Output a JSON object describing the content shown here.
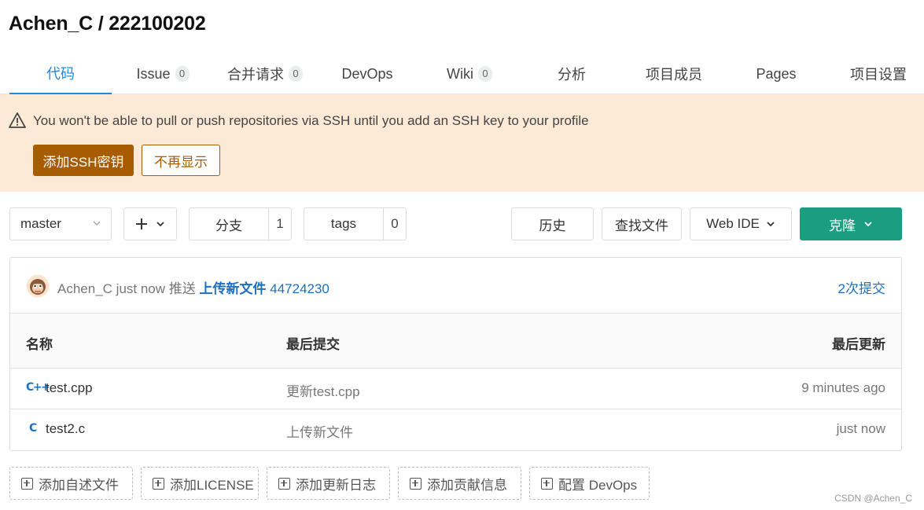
{
  "project_title": "Achen_C / 222100202",
  "tabs": [
    {
      "label": "代码",
      "active": true
    },
    {
      "label": "Issue",
      "count": "0"
    },
    {
      "label": "合并请求",
      "count": "0"
    },
    {
      "label": "DevOps"
    },
    {
      "label": "Wiki",
      "count": "0"
    },
    {
      "label": "分析"
    },
    {
      "label": "项目成员"
    },
    {
      "label": "Pages"
    },
    {
      "label": "项目设置"
    }
  ],
  "alert": {
    "message": "You won't be able to pull or push repositories via SSH until you add an SSH key to your profile",
    "primary_button": "添加SSH密钥",
    "secondary_button": "不再显示",
    "icon": "warning-icon"
  },
  "toolbar": {
    "branch": "master",
    "branches_label": "分支",
    "branches_count": "1",
    "tags_label": "tags",
    "tags_count": "0",
    "history": "历史",
    "find_file": "查找文件",
    "web_ide": "Web IDE",
    "clone": "克隆"
  },
  "last_commit": {
    "author": "Achen_C",
    "time": "just now",
    "action": "推送",
    "message": "上传新文件",
    "sha": "44724230",
    "commit_count": "2次提交"
  },
  "table": {
    "headers": {
      "name": "名称",
      "last_commit": "最后提交",
      "last_update": "最后更新"
    },
    "rows": [
      {
        "icon": "C++",
        "name": "test.cpp",
        "commit": "更新test.cpp",
        "updated": "9 minutes ago"
      },
      {
        "icon": "C",
        "name": "test2.c",
        "commit": "上传新文件",
        "updated": "just now"
      }
    ]
  },
  "add_buttons": [
    "添加自述文件",
    "添加LICENSE",
    "添加更新日志",
    "添加贡献信息",
    "配置 DevOps"
  ],
  "watermark": "CSDN @Achen_C",
  "colors": {
    "accent": "#1e8bdc",
    "warning_bg": "#fce9d6",
    "warning_button": "#a75c02",
    "clone_button": "#1b9d81",
    "link": "#1d6fc0"
  }
}
